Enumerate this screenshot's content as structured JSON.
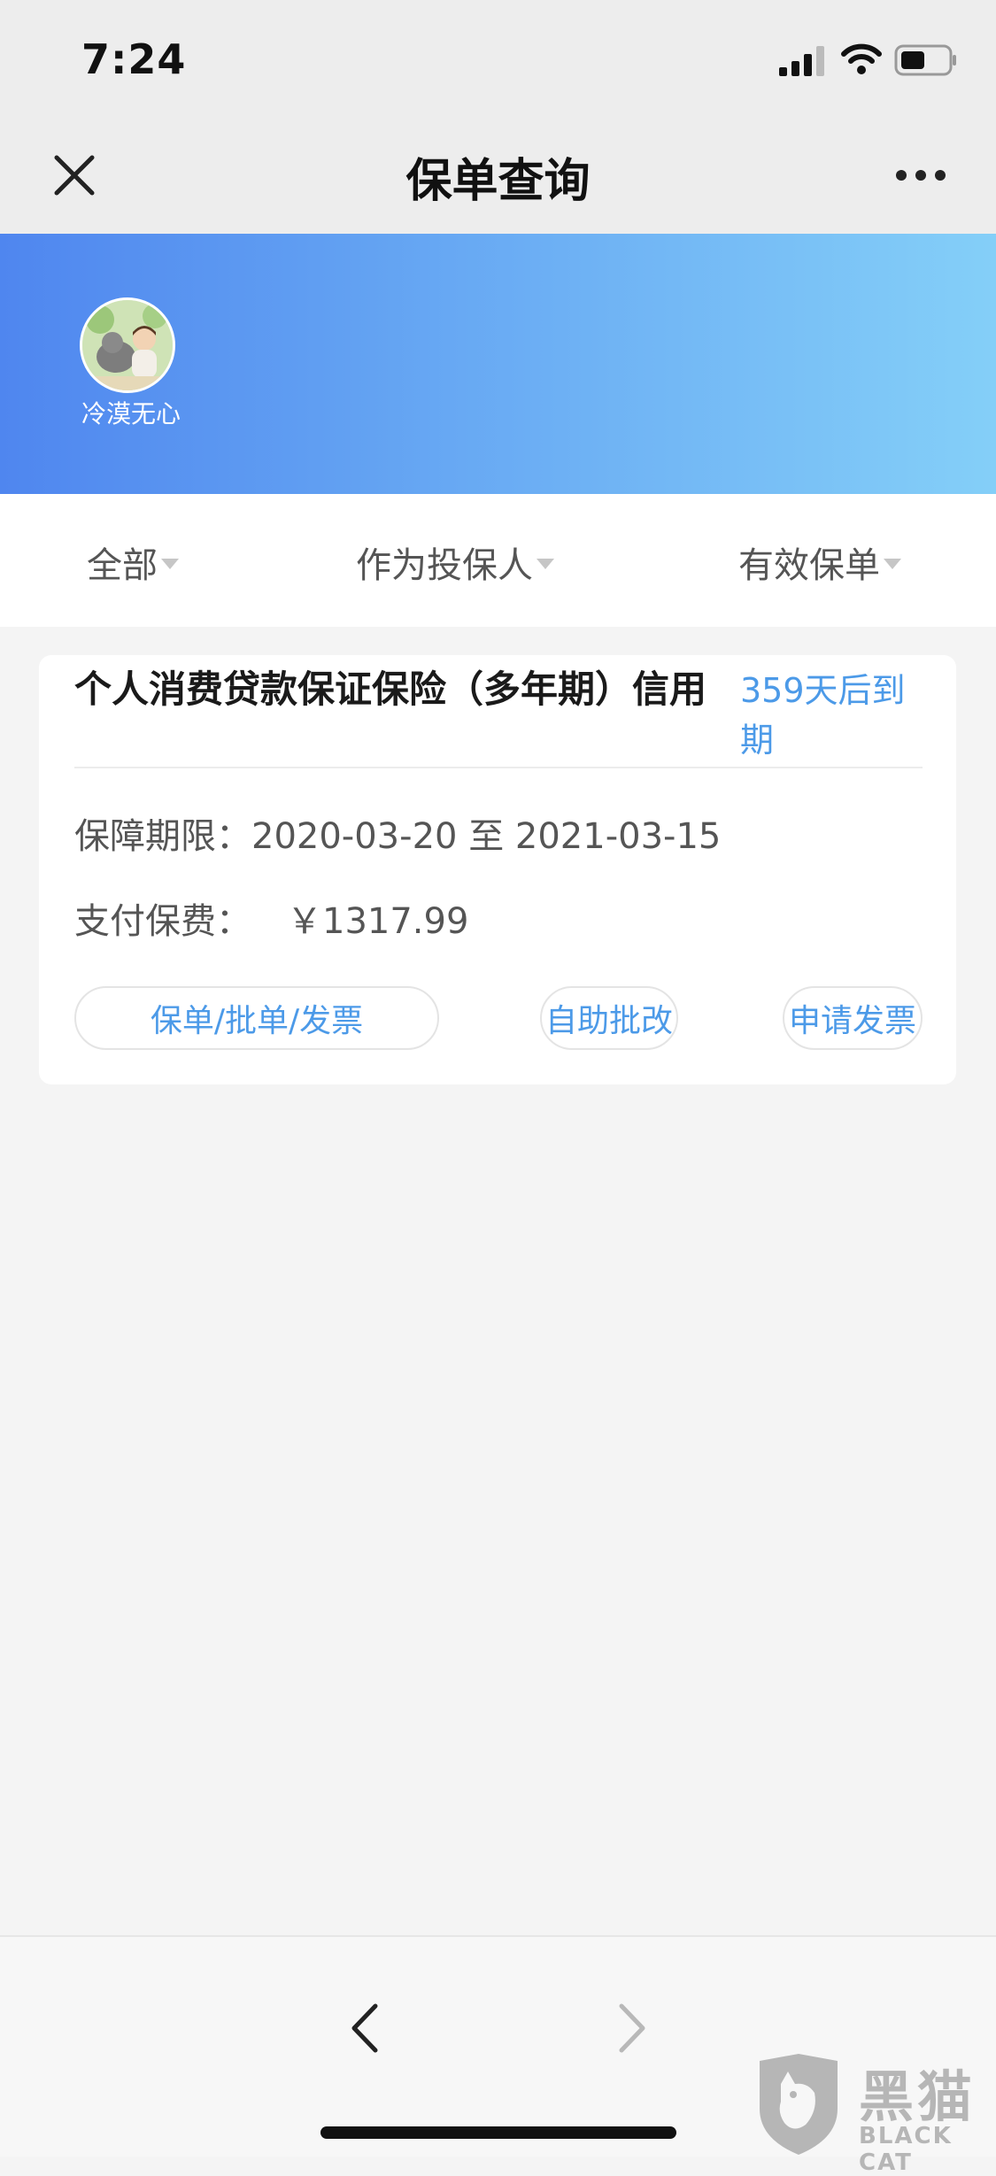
{
  "status_bar": {
    "time": "7:24"
  },
  "nav": {
    "title": "保单查询"
  },
  "profile": {
    "username": "冷漠无心"
  },
  "filters": {
    "scope": "全部",
    "role": "作为投保人",
    "status": "有效保单"
  },
  "policy": {
    "name": "个人消费贷款保证保险（多年期）信用",
    "expiry": "359天后到期",
    "coverage_label": "保障期限：",
    "coverage_start": "2020-03-20",
    "coverage_to": "至",
    "coverage_end": "2021-03-15",
    "premium_label": "支付保费：",
    "premium_amount": "￥1317.99",
    "actions": {
      "documents": "保单/批单/发票",
      "endorse": "自助批改",
      "invoice": "申请发票"
    }
  },
  "watermark": {
    "title": "黑猫",
    "subtitle": "BLACK CAT"
  },
  "colors": {
    "accent_blue": "#4c9ae8",
    "banner_start": "#4f86ef",
    "banner_end": "#84cff8",
    "background": "#f4f4f4"
  }
}
